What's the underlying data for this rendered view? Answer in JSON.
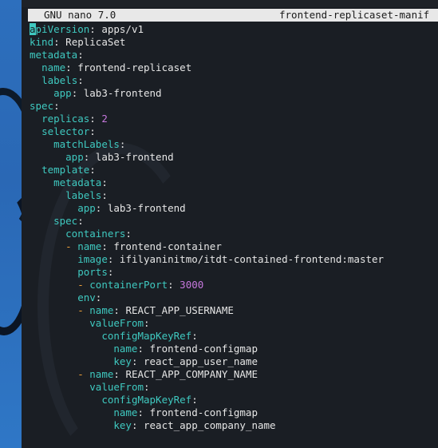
{
  "titlebar": {
    "version": "GNU nano 7.0",
    "filename": "frontend-replicaset-manif"
  },
  "lines": [
    {
      "indent": 0,
      "key": "apiVersion",
      "value": "apps/v1"
    },
    {
      "indent": 0,
      "key": "kind",
      "value": "ReplicaSet"
    },
    {
      "indent": 0,
      "key": "metadata",
      "value": ""
    },
    {
      "indent": 2,
      "key": "name",
      "value": "frontend-replicaset"
    },
    {
      "indent": 2,
      "key": "labels",
      "value": ""
    },
    {
      "indent": 4,
      "key": "app",
      "value": "lab3-frontend"
    },
    {
      "indent": 0,
      "key": "spec",
      "value": ""
    },
    {
      "indent": 2,
      "key": "replicas",
      "value": "2",
      "numeric": true
    },
    {
      "indent": 2,
      "key": "selector",
      "value": ""
    },
    {
      "indent": 4,
      "key": "matchLabels",
      "value": ""
    },
    {
      "indent": 6,
      "key": "app",
      "value": "lab3-frontend"
    },
    {
      "indent": 2,
      "key": "template",
      "value": ""
    },
    {
      "indent": 4,
      "key": "metadata",
      "value": ""
    },
    {
      "indent": 6,
      "key": "labels",
      "value": ""
    },
    {
      "indent": 8,
      "key": "app",
      "value": "lab3-frontend"
    },
    {
      "indent": 4,
      "key": "spec",
      "value": ""
    },
    {
      "indent": 6,
      "key": "containers",
      "value": ""
    },
    {
      "indent": 6,
      "dash": true,
      "key": "name",
      "value": "frontend-container"
    },
    {
      "indent": 8,
      "key": "image",
      "value": "ifilyaninitmo/itdt-contained-frontend:master"
    },
    {
      "indent": 8,
      "key": "ports",
      "value": ""
    },
    {
      "indent": 8,
      "dash": true,
      "key": "containerPort",
      "value": "3000",
      "numeric": true
    },
    {
      "indent": 8,
      "key": "env",
      "value": ""
    },
    {
      "indent": 8,
      "dash": true,
      "key": "name",
      "value": "REACT_APP_USERNAME"
    },
    {
      "indent": 10,
      "key": "valueFrom",
      "value": ""
    },
    {
      "indent": 12,
      "key": "configMapKeyRef",
      "value": ""
    },
    {
      "indent": 14,
      "key": "name",
      "value": "frontend-configmap"
    },
    {
      "indent": 14,
      "key": "key",
      "value": "react_app_user_name"
    },
    {
      "indent": 8,
      "dash": true,
      "key": "name",
      "value": "REACT_APP_COMPANY_NAME"
    },
    {
      "indent": 10,
      "key": "valueFrom",
      "value": ""
    },
    {
      "indent": 12,
      "key": "configMapKeyRef",
      "value": ""
    },
    {
      "indent": 14,
      "key": "name",
      "value": "frontend-configmap"
    },
    {
      "indent": 14,
      "key": "key",
      "value": "react_app_company_name"
    }
  ],
  "colors": {
    "key": "#3fc9c0",
    "number": "#c678dd",
    "dash": "#f0a23a",
    "text": "#e6e6e6",
    "background": "#1a1e24",
    "titlebar": "#e8e8e8"
  }
}
